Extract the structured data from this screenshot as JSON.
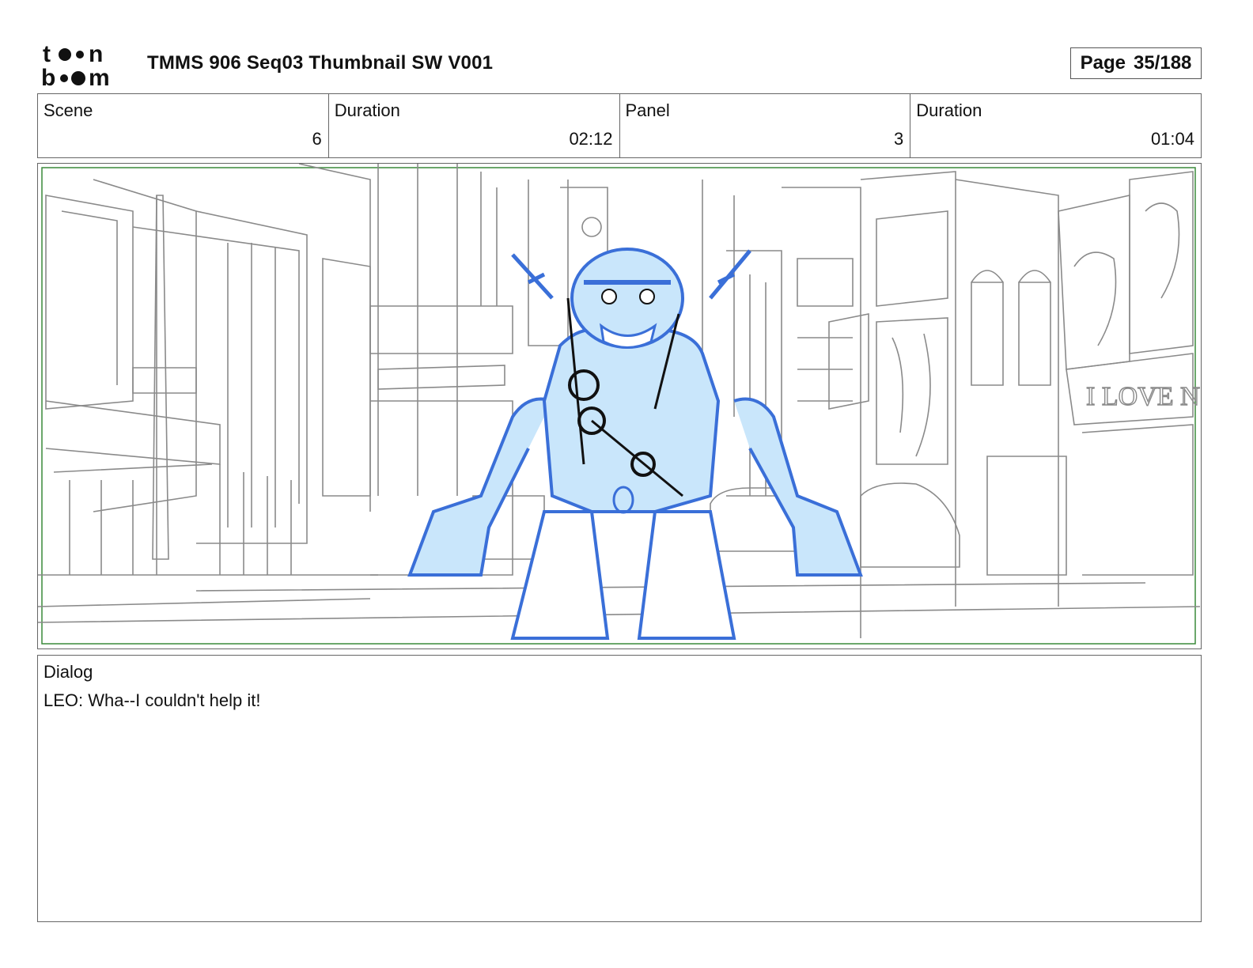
{
  "header": {
    "logo_text": "toon boom",
    "title": "TMMS 906 Seq03 Thumbnail SW V001",
    "page_label": "Page",
    "page_number": "35/188"
  },
  "info": {
    "scene_label": "Scene",
    "scene_value": "6",
    "scene_duration_label": "Duration",
    "scene_duration_value": "02:12",
    "panel_label": "Panel",
    "panel_value": "3",
    "panel_duration_label": "Duration",
    "panel_duration_value": "01:04"
  },
  "panel": {
    "billboard_text": "I LOVE NY GIFT",
    "colors": {
      "character_line": "#3a6fd8",
      "character_fill": "#c9e6fb",
      "background_line": "#8a8a8a",
      "frame_border": "#3a8a3a"
    }
  },
  "dialog": {
    "label": "Dialog",
    "text": "LEO: Wha--I couldn't help it!"
  }
}
